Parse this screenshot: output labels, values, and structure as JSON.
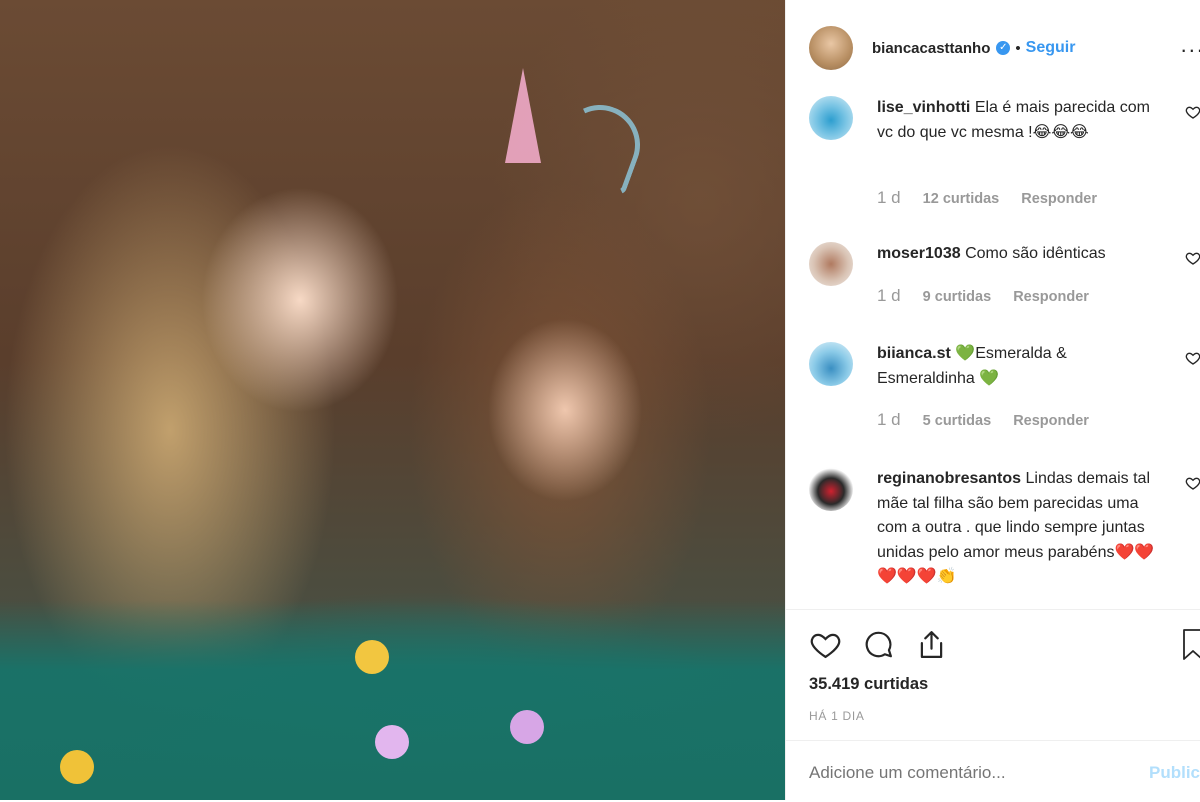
{
  "header": {
    "username": "biancacasttanho",
    "verified_glyph": "✓",
    "separator": "•",
    "follow_label": "Seguir",
    "more_glyph": "..."
  },
  "comments": [
    {
      "username": "lise_vinhotti",
      "text": "Ela é mais parecida com vc do que vc mesma !😂😂😂",
      "ago": "1 d",
      "likes": "12 curtidas",
      "reply": "Responder"
    },
    {
      "username": "moser1038",
      "text": "Como são idênticas",
      "ago": "1 d",
      "likes": "9 curtidas",
      "reply": "Responder"
    },
    {
      "username": "biianca.st",
      "text": "💚Esmeralda & Esmeraldinha 💚",
      "ago": "1 d",
      "likes": "5 curtidas",
      "reply": "Responder"
    },
    {
      "username": "reginanobresantos",
      "text": "Lindas demais tal mãe tal filha são bem parecidas uma com a outra . que lindo sempre juntas unidas pelo amor meus parabéns❤️❤️❤️❤️❤️👏"
    }
  ],
  "footer": {
    "likes": "35.419 curtidas",
    "time": "HÁ 1 DIA",
    "comment_placeholder": "Adicione um comentário...",
    "publish_label": "Publicar"
  },
  "icons": {
    "like": "heart-icon",
    "comment": "comment-icon",
    "share": "share-icon",
    "save": "bookmark-icon"
  },
  "colors": {
    "link": "#3897f0",
    "muted": "#999999",
    "publish_disabled": "#b2dffc"
  }
}
